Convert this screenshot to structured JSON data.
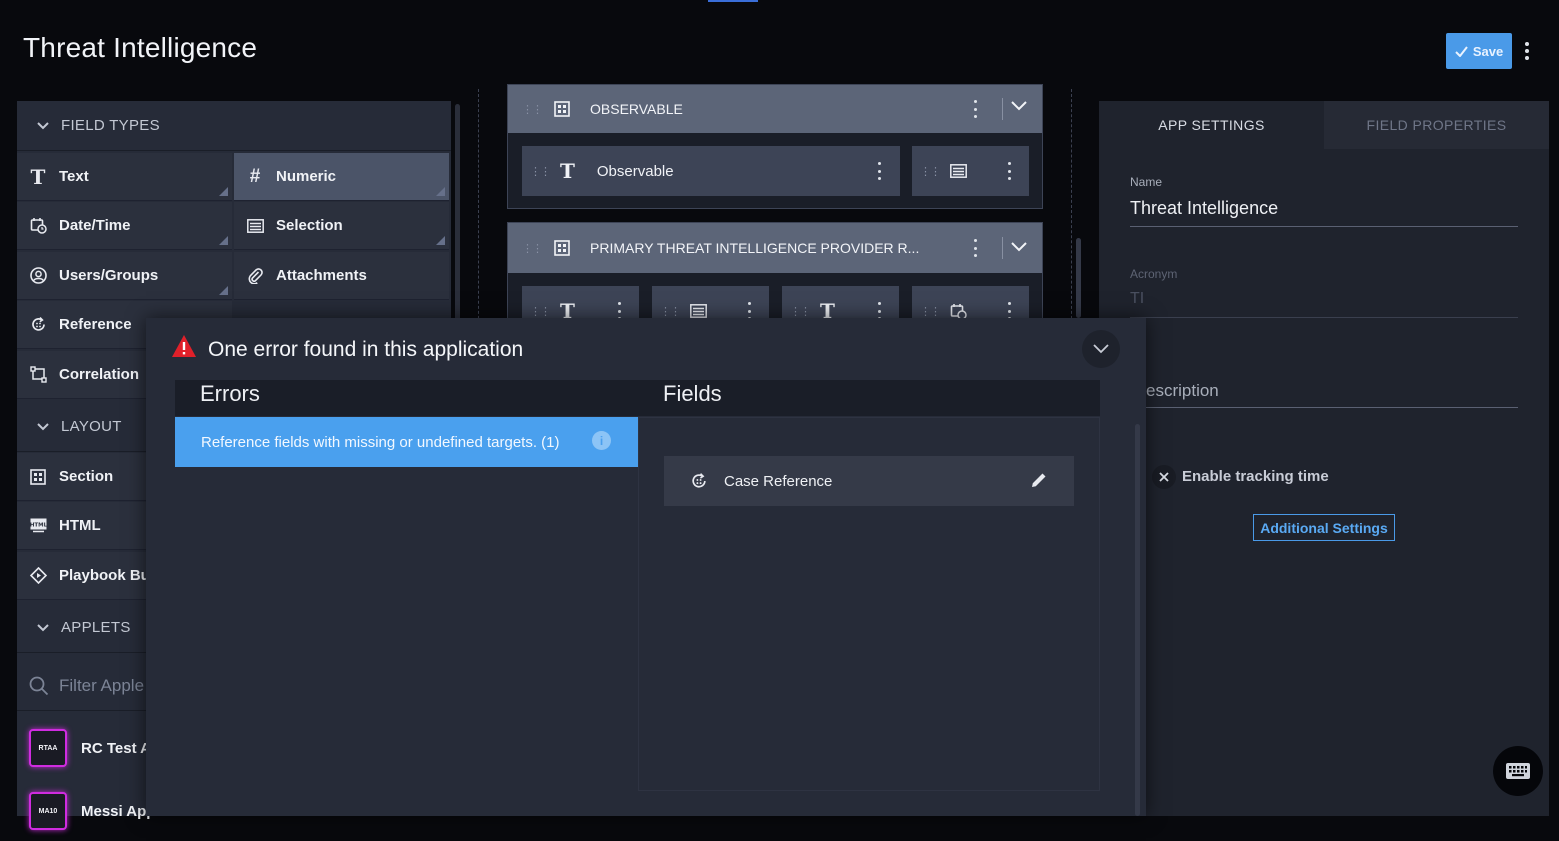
{
  "app": {
    "title": "Threat Intelligence",
    "save_label": "Save"
  },
  "left_panel": {
    "field_types_header": "FIELD TYPES",
    "field_types": [
      {
        "label": "Text",
        "icon": "text-icon"
      },
      {
        "label": "Numeric",
        "icon": "hash-icon",
        "active": true
      },
      {
        "label": "Date/Time",
        "icon": "calendar-clock-icon"
      },
      {
        "label": "Selection",
        "icon": "list-icon"
      },
      {
        "label": "Users/Groups",
        "icon": "user-circle-icon"
      },
      {
        "label": "Attachments",
        "icon": "paperclip-icon"
      },
      {
        "label": "Reference",
        "icon": "reference-icon"
      },
      {
        "label": "Correlation",
        "icon": "correlation-icon"
      }
    ],
    "layout_header": "LAYOUT",
    "layout_items": [
      {
        "label": "Section",
        "icon": "grid-icon"
      },
      {
        "label": "HTML",
        "icon": "html-icon"
      },
      {
        "label": "Playbook Bu",
        "icon": "playbook-icon"
      }
    ],
    "applets_header": "APPLETS",
    "filter_placeholder": "Filter Apple",
    "applets": [
      {
        "logo": "RTAA",
        "label": "RC Test Al"
      },
      {
        "logo": "MA10",
        "label": "Messi App"
      }
    ]
  },
  "canvas": {
    "sections": [
      {
        "title": "OBSERVABLE",
        "fields": [
          {
            "label": "Observable",
            "icon": "text-icon"
          },
          {
            "label": "",
            "icon": "list-icon"
          }
        ]
      },
      {
        "title": "PRIMARY THREAT INTELLIGENCE PROVIDER R...",
        "fields": [
          {
            "icon": "text-icon"
          },
          {
            "icon": "list-icon"
          },
          {
            "icon": "text-icon"
          },
          {
            "icon": "calendar-clock-icon"
          }
        ]
      }
    ]
  },
  "right_panel": {
    "tabs": [
      "APP SETTINGS",
      "FIELD PROPERTIES"
    ],
    "name_label": "Name",
    "name_value": "Threat Intelligence",
    "acronym_label": "Acronym",
    "acronym_value": "TI",
    "description_label": "escription",
    "tracking_label": "Enable tracking time",
    "additional_settings": "Additional Settings"
  },
  "error_modal": {
    "title": "One error found in this application",
    "errors_header": "Errors",
    "fields_header": "Fields",
    "error_item": "Reference fields with missing or undefined targets. (1)",
    "field_item": "Case Reference",
    "info_glyph": "i"
  },
  "colors": {
    "accent": "#4a9ae8",
    "error_highlight": "#4aa0ee",
    "warning": "#e0202a",
    "applet_border": "#d02ce0"
  }
}
